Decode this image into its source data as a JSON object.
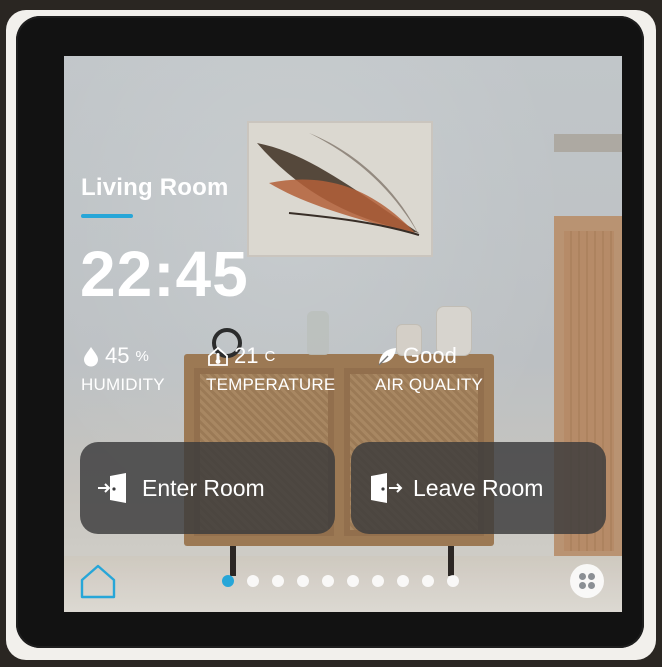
{
  "room": {
    "title": "Living Room"
  },
  "clock": {
    "time": "22:45"
  },
  "stats": [
    {
      "icon": "water-drop-icon",
      "value": "45",
      "unit": "%",
      "label": "HUMIDITY"
    },
    {
      "icon": "thermometer-house-icon",
      "value": "21",
      "unit": "C",
      "label": "TEMPERATURE"
    },
    {
      "icon": "leaf-icon",
      "value": "Good",
      "unit": "",
      "label": "AIR QUALITY"
    }
  ],
  "actions": [
    {
      "icon": "enter-room-icon",
      "label": "Enter Room"
    },
    {
      "icon": "leave-room-icon",
      "label": "Leave Room"
    }
  ],
  "pager": {
    "pages": 10,
    "current": 1
  },
  "colors": {
    "accent": "#27a6d8",
    "button_bg": "#3a3a3c",
    "text": "#ffffff"
  }
}
